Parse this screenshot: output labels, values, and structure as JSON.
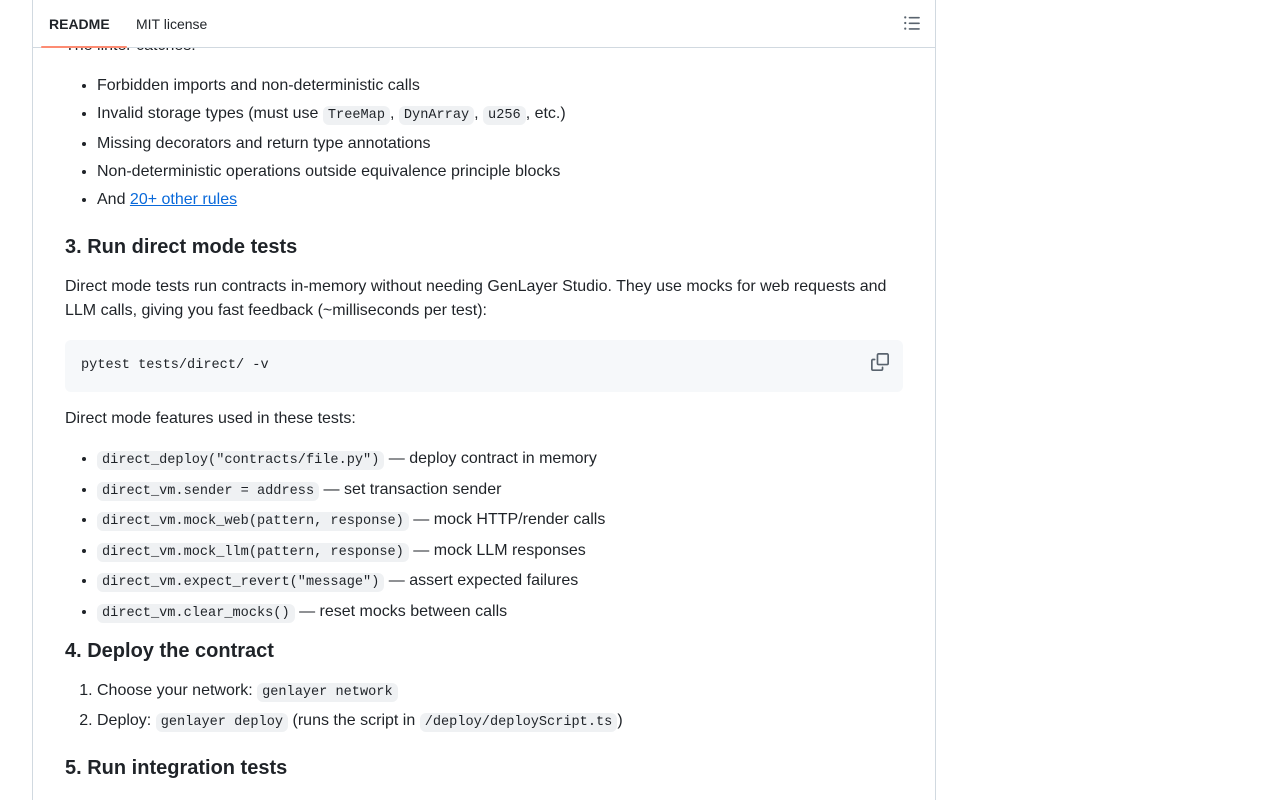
{
  "tabs": {
    "readme": "README",
    "license": "MIT license"
  },
  "intro_partial": "The linter catches:",
  "linter_items": {
    "forbidden": "Forbidden imports and non-deterministic calls",
    "invalid_prefix": "Invalid storage types (must use ",
    "code_treemap": "TreeMap",
    "sep1": ", ",
    "code_dynarray": "DynArray",
    "sep2": ", ",
    "code_u256": "u256",
    "invalid_suffix": ", etc.)",
    "missing": "Missing decorators and return type annotations",
    "nondet": "Non-deterministic operations outside equivalence principle blocks",
    "and_prefix": "And ",
    "other_rules_link": "20+ other rules"
  },
  "section3": {
    "heading": "3. Run direct mode tests",
    "description": "Direct mode tests run contracts in-memory without needing GenLayer Studio. They use mocks for web requests and LLM calls, giving you fast feedback (~milliseconds per test):",
    "command": "pytest tests/direct/ -v",
    "features_intro": "Direct mode features used in these tests:",
    "features": [
      {
        "code": "direct_deploy(\"contracts/file.py\")",
        "desc": " — deploy contract in memory"
      },
      {
        "code": "direct_vm.sender = address",
        "desc": " — set transaction sender"
      },
      {
        "code": "direct_vm.mock_web(pattern, response)",
        "desc": " — mock HTTP/render calls"
      },
      {
        "code": "direct_vm.mock_llm(pattern, response)",
        "desc": " — mock LLM responses"
      },
      {
        "code": "direct_vm.expect_revert(\"message\")",
        "desc": " — assert expected failures"
      },
      {
        "code": "direct_vm.clear_mocks()",
        "desc": " — reset mocks between calls"
      }
    ]
  },
  "section4": {
    "heading": "4. Deploy the contract",
    "step1_prefix": "Choose your network: ",
    "step1_code": "genlayer network",
    "step2_prefix": "Deploy: ",
    "step2_code": "genlayer deploy",
    "step2_mid": " (runs the script in ",
    "step2_path": "/deploy/deployScript.ts",
    "step2_suffix": ")"
  },
  "section5": {
    "heading": "5. Run integration tests"
  },
  "colors": {
    "link": "#0969da",
    "tab_underline": "#fd8c73",
    "code_bg": "#eff1f3",
    "codeblock_bg": "#f6f8fa",
    "border": "#d1d9e0"
  },
  "icons": {
    "copy": "copy-icon",
    "outline": "list-unordered-icon"
  }
}
